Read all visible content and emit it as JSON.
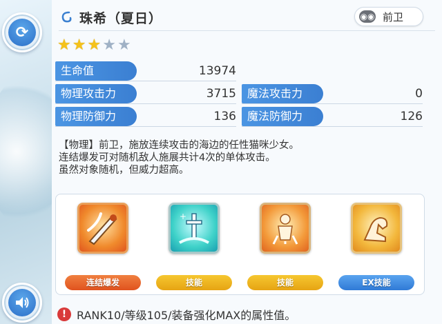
{
  "character": {
    "name": "珠希（夏日）",
    "role": "前卫",
    "stars_filled": 3,
    "stars_total": 5
  },
  "stats": {
    "hp": {
      "label": "生命值",
      "value": "13974"
    },
    "phys_atk": {
      "label": "物理攻击力",
      "value": "3715"
    },
    "magic_atk": {
      "label": "魔法攻击力",
      "value": "0"
    },
    "phys_def": {
      "label": "物理防御力",
      "value": "136"
    },
    "magic_def": {
      "label": "魔法防御力",
      "value": "126"
    }
  },
  "description": [
    "【物理】前卫，施放连续攻击的海边的任性猫咪少女。",
    "连结爆发可对随机敌人施展共计4次的单体攻击。",
    "虽然对象随机，但威力超高。"
  ],
  "skills": [
    {
      "label": "连结爆发",
      "icon": "sword-slash-icon",
      "pill_color": "#e8642c",
      "frame_color": "#e86a2d"
    },
    {
      "label": "技能",
      "icon": "ice-sword-icon",
      "pill_color": "#e9b21a",
      "frame_color": "#2cc0b7"
    },
    {
      "label": "技能",
      "icon": "power-up-icon",
      "pill_color": "#e9b21a",
      "frame_color": "#ee7a2a"
    },
    {
      "label": "EX技能",
      "icon": "flexed-arm-icon",
      "pill_color": "#3d8ee3",
      "frame_color": "#f0b238"
    }
  ],
  "footnote": "RANK10/等级105/装备强化MAX的属性值。",
  "colors": {
    "stat_label_bg": "#3b7fd2",
    "star_on": "#f5c21a",
    "star_off": "#9fb1c5",
    "warning": "#d93a3a"
  }
}
